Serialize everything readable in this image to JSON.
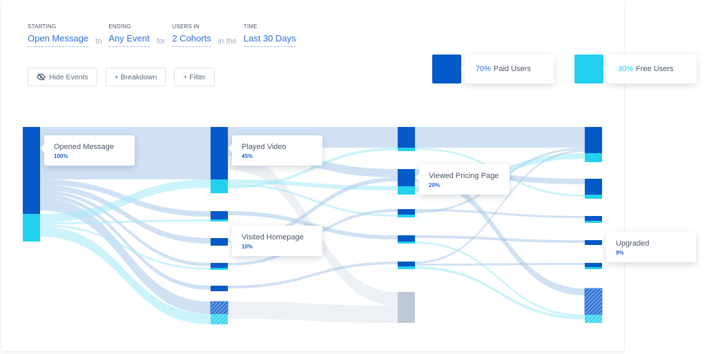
{
  "query": {
    "starting": {
      "label": "STARTING",
      "value": "Open Message"
    },
    "join_to": "to",
    "ending": {
      "label": "ENDING",
      "value": "Any Event"
    },
    "join_for": "for",
    "users_in": {
      "label": "USERS IN",
      "value": "2 Cohorts"
    },
    "join_in": "in the",
    "time": {
      "label": "TIME",
      "value": "Last 30 Days"
    }
  },
  "toolbar": {
    "hide_events": {
      "label": "Hide Events",
      "icon": "eye-slash-icon"
    },
    "breakdown": {
      "label": "+ Breakdown"
    },
    "filter": {
      "label": "+ Filter"
    }
  },
  "legend": [
    {
      "pct": "70%",
      "label": "Paid Users",
      "color": "#0559c9",
      "pct_color": "#2a6fdb"
    },
    {
      "pct": "30%",
      "label": "Free Users",
      "color": "#23d1ef",
      "pct_color": "#23c8ea"
    }
  ],
  "colors": {
    "paid": "#0559c9",
    "free": "#23d1ef",
    "paid_link": "#a9c8ea",
    "free_link": "#a9ebf7",
    "dropoff": "#bec8d6",
    "dropoff_link": "#e9ecf3"
  },
  "chart_data": {
    "type": "sankey",
    "title": "",
    "series": [
      {
        "name": "Paid Users",
        "share": 0.7
      },
      {
        "name": "Free Users",
        "share": 0.3
      }
    ],
    "columns": [
      {
        "step": 1,
        "nodes": [
          {
            "id": "c1n1",
            "label": "Opened Message",
            "pct": "100%",
            "paid": 126,
            "free": 40
          }
        ]
      },
      {
        "step": 2,
        "nodes": [
          {
            "id": "c2n1",
            "label": "Played Video",
            "pct": "45%",
            "paid": 76,
            "free": 20
          },
          {
            "id": "c2n2",
            "label": "",
            "paid": 12,
            "free": 3
          },
          {
            "id": "c2n3",
            "label": "Visited Homepage",
            "pct": "10%",
            "paid": 11,
            "free": 0
          },
          {
            "id": "c2n4",
            "label": "",
            "paid": 7,
            "free": 3
          },
          {
            "id": "c2n5",
            "label": "",
            "paid": 8,
            "free": 0
          },
          {
            "id": "c2n6",
            "label": "",
            "paid": 18,
            "free": 15,
            "hatched": true
          }
        ]
      },
      {
        "step": 3,
        "nodes": [
          {
            "id": "c3n1",
            "label": "",
            "paid": 30,
            "free": 5
          },
          {
            "id": "c3n2",
            "label": "Viewed Pricing Page",
            "pct": "20%",
            "paid": 25,
            "free": 12
          },
          {
            "id": "c3n3",
            "label": "",
            "paid": 8,
            "free": 4
          },
          {
            "id": "c3n4",
            "label": "",
            "paid": 9,
            "free": 3
          },
          {
            "id": "c3n5",
            "label": "",
            "paid": 7,
            "free": 4
          },
          {
            "id": "c3n6",
            "label": "",
            "dropoff": 45
          }
        ]
      },
      {
        "step": 4,
        "nodes": [
          {
            "id": "c4n1",
            "label": "",
            "paid": 38,
            "free": 13
          },
          {
            "id": "c4n2",
            "label": "",
            "paid": 23,
            "free": 6
          },
          {
            "id": "c4n3",
            "label": "",
            "paid": 7,
            "free": 3
          },
          {
            "id": "c4n4",
            "label": "Upgraded",
            "pct": "9%",
            "paid": 7,
            "free": 0
          },
          {
            "id": "c4n5",
            "label": "",
            "paid": 6,
            "free": 3
          },
          {
            "id": "c4n6",
            "label": "",
            "paid": 38,
            "free": 12,
            "hatched": true
          }
        ]
      }
    ],
    "links": [
      {
        "from": "c1n1",
        "to": "c2n1",
        "kind": "paid",
        "value": 76
      },
      {
        "from": "c1n1",
        "to": "c2n2",
        "kind": "paid",
        "value": 8
      },
      {
        "from": "c1n1",
        "to": "c2n3",
        "kind": "paid",
        "value": 8
      },
      {
        "from": "c1n1",
        "to": "c2n4",
        "kind": "paid",
        "value": 5
      },
      {
        "from": "c1n1",
        "to": "c2n5",
        "kind": "paid",
        "value": 6
      },
      {
        "from": "c1n1",
        "to": "c2n6",
        "kind": "paid",
        "value": 18
      },
      {
        "from": "c1n1",
        "to": "c2n1",
        "kind": "free",
        "value": 12
      },
      {
        "from": "c1n1",
        "to": "c2n2",
        "kind": "free",
        "value": 3
      },
      {
        "from": "c1n1",
        "to": "c2n4",
        "kind": "free",
        "value": 3
      },
      {
        "from": "c1n1",
        "to": "c2n6",
        "kind": "free",
        "value": 15
      },
      {
        "from": "c2n1",
        "to": "c3n1",
        "kind": "paid",
        "value": 30
      },
      {
        "from": "c2n1",
        "to": "c3n2",
        "kind": "paid",
        "value": 12
      },
      {
        "from": "c2n1",
        "to": "c3n6",
        "kind": "dropoff",
        "value": 20
      },
      {
        "from": "c2n1",
        "to": "c3n2",
        "kind": "free",
        "value": 6
      },
      {
        "from": "c2n1",
        "to": "c3n3",
        "kind": "free",
        "value": 3
      },
      {
        "from": "c2n1",
        "to": "c3n1",
        "kind": "free",
        "value": 4
      },
      {
        "from": "c2n2",
        "to": "c3n4",
        "kind": "paid",
        "value": 6
      },
      {
        "from": "c2n3",
        "to": "c3n2",
        "kind": "paid",
        "value": 6
      },
      {
        "from": "c2n4",
        "to": "c3n3",
        "kind": "paid",
        "value": 4
      },
      {
        "from": "c2n5",
        "to": "c3n5",
        "kind": "paid",
        "value": 4
      },
      {
        "from": "c2n6",
        "to": "c3n6",
        "kind": "dropoff",
        "value": 25
      },
      {
        "from": "c3n1",
        "to": "c4n1",
        "kind": "paid",
        "value": 30
      },
      {
        "from": "c3n1",
        "to": "c4n2",
        "kind": "free",
        "value": 3
      },
      {
        "from": "c3n2",
        "to": "c4n2",
        "kind": "paid",
        "value": 8
      },
      {
        "from": "c3n2",
        "to": "c4n6",
        "kind": "paid",
        "value": 10
      },
      {
        "from": "c3n2",
        "to": "c4n1",
        "kind": "free",
        "value": 8
      },
      {
        "from": "c3n3",
        "to": "c4n3",
        "kind": "paid",
        "value": 3
      },
      {
        "from": "c3n3",
        "to": "c4n1",
        "kind": "paid",
        "value": 3
      },
      {
        "from": "c3n4",
        "to": "c4n4",
        "kind": "paid",
        "value": 4
      },
      {
        "from": "c3n4",
        "to": "c4n6",
        "kind": "free",
        "value": 3
      },
      {
        "from": "c3n5",
        "to": "c4n1",
        "kind": "paid",
        "value": 3
      },
      {
        "from": "c3n5",
        "to": "c4n5",
        "kind": "paid",
        "value": 3
      },
      {
        "from": "c3n5",
        "to": "c4n6",
        "kind": "free",
        "value": 4
      }
    ]
  }
}
